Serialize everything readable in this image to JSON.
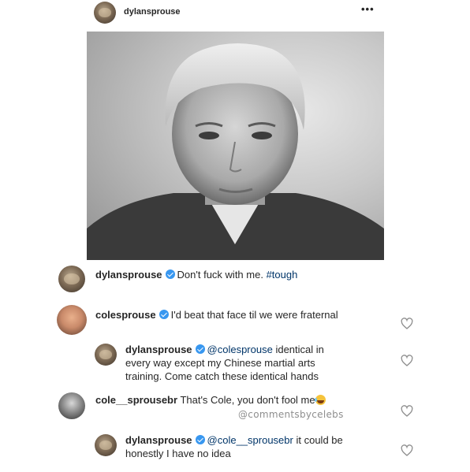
{
  "post": {
    "username": "dylansprouse",
    "more_icon": "more-horizontal-icon",
    "more_label": "•••"
  },
  "photo": {
    "icon": "photo-portrait"
  },
  "caption": {
    "username": "dylansprouse",
    "text": "Don't fuck with me.",
    "hashtag": "#tough"
  },
  "comments": [
    {
      "username": "colesprouse",
      "verified": true,
      "text": "I'd beat that face til we were fraternal"
    },
    {
      "username": "dylansprouse",
      "verified": true,
      "mention": "@colesprouse",
      "line1": "identical in",
      "line2": "every way except my Chinese martial arts",
      "line3": "training. Come catch these identical hands"
    },
    {
      "username": "cole__sprousebr",
      "verified": false,
      "text": "That's Cole, you don't fool me",
      "emoji": "laughing-crying-emoji"
    },
    {
      "username": "dylansprouse",
      "verified": true,
      "mention": "@cole__sprousebr",
      "line1": "it could be",
      "line2": "honestly I have no idea"
    }
  ],
  "watermark": "@commentsbycelebs",
  "colors": {
    "text": "#262626",
    "verified": "#3897f0",
    "link": "#003569",
    "muted": "#8e8e8e"
  }
}
